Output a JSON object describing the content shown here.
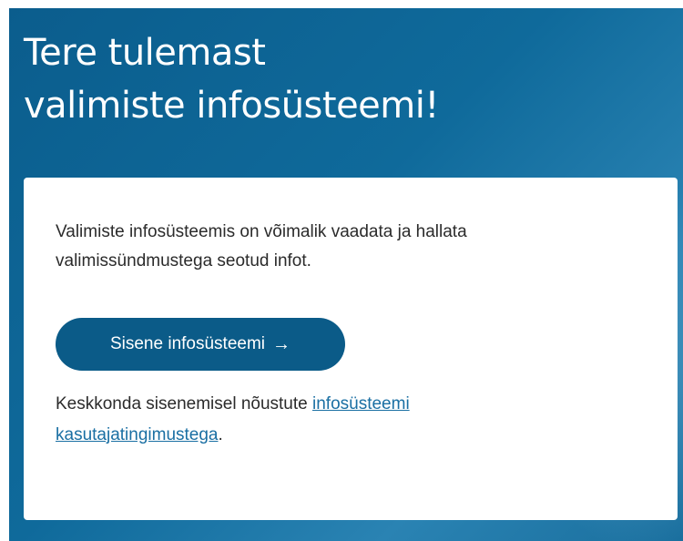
{
  "hero": {
    "title_line1": "Tere tulemast",
    "title_line2": "valimiste infosüsteemi!"
  },
  "card": {
    "intro_text": "Valimiste infosüsteemis on võimalik vaadata ja hallata valimissündmustega seotud infot.",
    "enter_button_label": "Sisene infosüsteemi",
    "enter_button_icon": "arrow-right-icon",
    "enter_button_arrow": "→",
    "terms_prefix": "Keskkonda sisenemisel nõustute ",
    "terms_link": "infosüsteemi kasutajatingimustega",
    "terms_suffix": "."
  },
  "colors": {
    "background": "#0b5d8d",
    "button": "#0b5b88",
    "link": "#1a6fa3",
    "text": "#2b2b2b"
  }
}
